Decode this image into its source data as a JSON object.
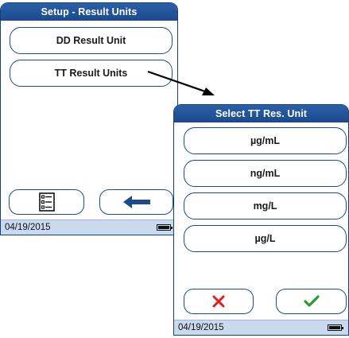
{
  "setup_screen": {
    "title": "Setup - Result Units",
    "options": [
      "DD Result Unit",
      "TT Result Units"
    ],
    "status_date": "04/19/2015",
    "softkeys": {
      "left_icon": "list-menu-icon",
      "right_icon": "back-arrow-icon"
    }
  },
  "select_screen": {
    "title": "Select TT Res. Unit",
    "options": [
      "µg/mL",
      "ng/mL",
      "mg/L",
      "µg/L"
    ],
    "status_date": "04/19/2015",
    "softkeys": {
      "left_icon": "cancel-x-icon",
      "right_icon": "confirm-check-icon"
    }
  },
  "colors": {
    "accent": "#1d4a8c",
    "status_bg": "#c9d9ee",
    "cancel": "#e02020",
    "confirm": "#2a9a2a"
  }
}
